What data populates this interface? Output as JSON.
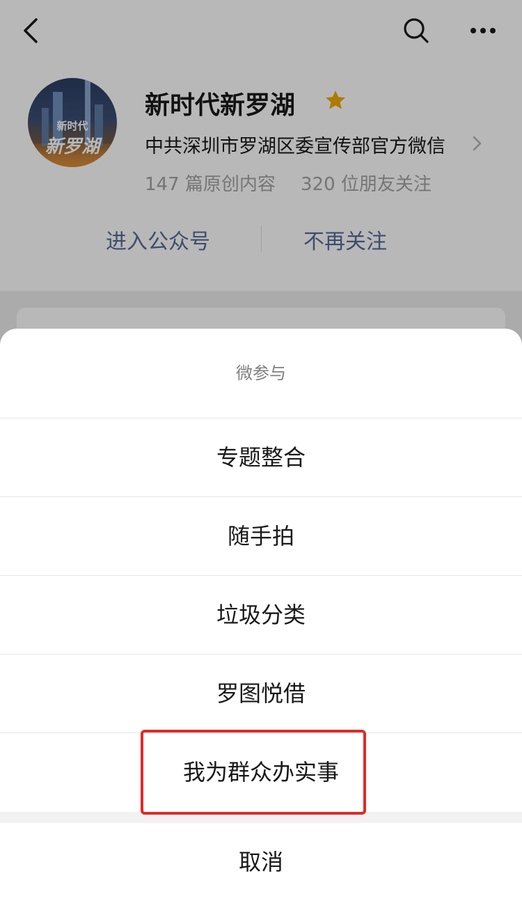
{
  "profile": {
    "account_name": "新时代新罗湖",
    "description": "中共深圳市罗湖区委宣传部官方微信",
    "stats": {
      "articles": "147 篇原创内容",
      "friends": "320 位朋友关注"
    },
    "avatar_text_small": "新时代",
    "avatar_text_big": "新罗湖",
    "actions": {
      "enter": "进入公众号",
      "unfollow": "不再关注"
    }
  },
  "nav": {
    "back_icon": "chevron-left-icon",
    "search_icon": "search-icon",
    "more_icon": "more-dots-icon"
  },
  "action_sheet": {
    "title": "微参与",
    "items": [
      {
        "label": "专题整合"
      },
      {
        "label": "随手拍"
      },
      {
        "label": "垃圾分类"
      },
      {
        "label": "罗图悦借"
      },
      {
        "label": "我为群众办实事"
      }
    ],
    "cancel": "取消",
    "highlighted_item": "我为群众办实事"
  },
  "colors": {
    "link_blue": "#576b95",
    "star_gold": "#f2a900",
    "highlight_red": "#e02a26"
  }
}
